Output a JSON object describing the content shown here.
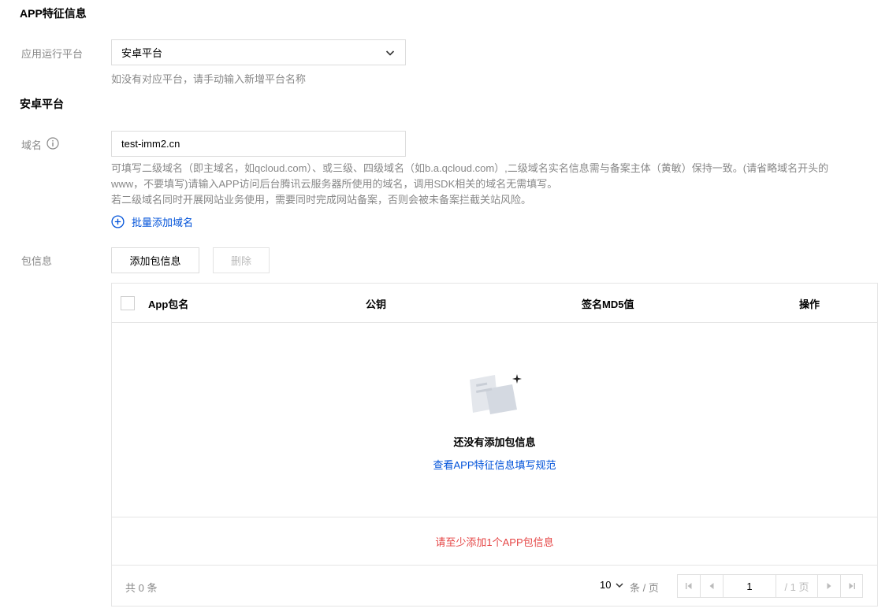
{
  "section1": {
    "title": "APP特征信息"
  },
  "platform": {
    "label": "应用运行平台",
    "selected": "安卓平台",
    "hint": "如没有对应平台，请手动输入新增平台名称"
  },
  "section2": {
    "title": "安卓平台"
  },
  "domain": {
    "label": "域名",
    "value": "test-imm2.cn",
    "desc_line1": "可填写二级域名（即主域名，如qcloud.com）、或三级、四级域名（如b.a.qcloud.com）,二级域名实名信息需与备案主体（黄敏）保持一致。(请省略域名开头的",
    "desc_line2": "www，不要填写)请输入APP访问后台腾讯云服务器所使用的域名，调用SDK相关的域名无需填写。",
    "desc_line3": "若二级域名同时开展网站业务使用，需要同时完成网站备案，否则会被未备案拦截关站风险。",
    "batch_add": "批量添加域名"
  },
  "package": {
    "label": "包信息",
    "add_button": "添加包信息",
    "delete_button": "删除"
  },
  "table": {
    "columns": [
      "App包名",
      "公钥",
      "签名MD5值",
      "操作"
    ],
    "empty_title": "还没有添加包信息",
    "empty_link": "查看APP特征信息填写规范",
    "warning": "请至少添加1个APP包信息"
  },
  "pagination": {
    "total": "共 0 条",
    "page_size": "10",
    "per_page_unit": "条 / 页",
    "current_page": "1",
    "total_pages": "/ 1 页"
  },
  "colors": {
    "link": "#0052d9",
    "warning": "#e54545",
    "border": "#dcdcdc",
    "muted": "#888888"
  },
  "icons": [
    "chevron-down-icon",
    "info-circle-icon",
    "plus-circle-icon",
    "empty-document-icon",
    "sparkle-icon",
    "first-page-icon",
    "prev-page-icon",
    "next-page-icon",
    "last-page-icon"
  ]
}
